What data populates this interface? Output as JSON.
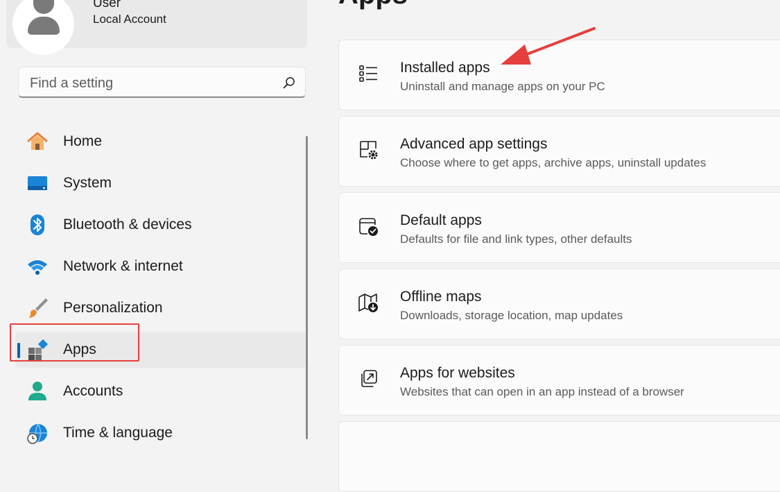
{
  "account": {
    "name": "User",
    "type": "Local Account"
  },
  "search": {
    "placeholder": "Find a setting"
  },
  "sidebar": {
    "items": [
      {
        "label": "Home",
        "icon": "home-icon"
      },
      {
        "label": "System",
        "icon": "system-icon"
      },
      {
        "label": "Bluetooth & devices",
        "icon": "bluetooth-icon"
      },
      {
        "label": "Network & internet",
        "icon": "wifi-icon"
      },
      {
        "label": "Personalization",
        "icon": "paintbrush-icon"
      },
      {
        "label": "Apps",
        "icon": "apps-icon",
        "selected": true
      },
      {
        "label": "Accounts",
        "icon": "accounts-icon"
      },
      {
        "label": "Time & language",
        "icon": "globe-clock-icon"
      }
    ]
  },
  "main": {
    "title": "Apps",
    "cards": [
      {
        "title": "Installed apps",
        "subtitle": "Uninstall and manage apps on your PC",
        "icon": "list-icon"
      },
      {
        "title": "Advanced app settings",
        "subtitle": "Choose where to get apps, archive apps, uninstall updates",
        "icon": "app-settings-icon"
      },
      {
        "title": "Default apps",
        "subtitle": "Defaults for file and link types, other defaults",
        "icon": "default-apps-icon"
      },
      {
        "title": "Offline maps",
        "subtitle": "Downloads, storage location, map updates",
        "icon": "offline-map-icon"
      },
      {
        "title": "Apps for websites",
        "subtitle": "Websites that can open in an app instead of a browser",
        "icon": "open-external-icon"
      }
    ]
  },
  "colors": {
    "accent": "#0063b1",
    "annotation": "#e5403f"
  }
}
